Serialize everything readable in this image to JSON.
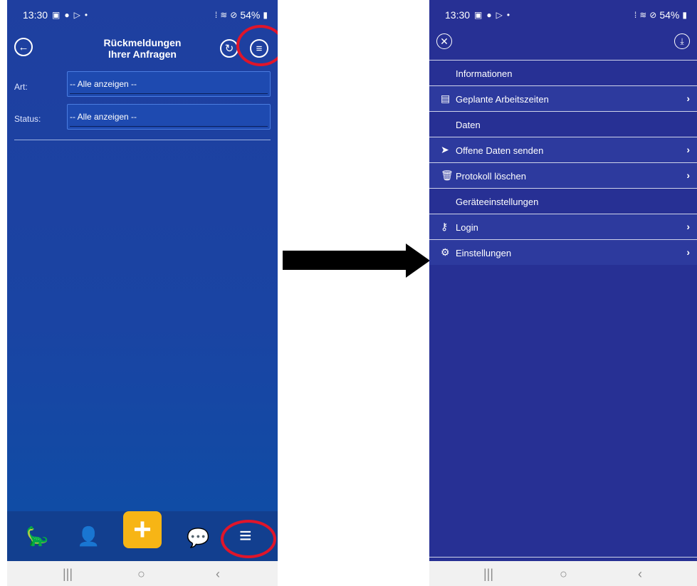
{
  "left": {
    "status": {
      "time": "13:30",
      "battery": "54%"
    },
    "header": {
      "title_line1": "Rückmeldungen",
      "title_line2": "Ihrer Anfragen"
    },
    "filters": [
      {
        "label": "Art:",
        "value": "-- Alle anzeigen --"
      },
      {
        "label": "Status:",
        "value": "-- Alle anzeigen --"
      }
    ],
    "icons": {
      "back": "back-arrow-icon",
      "refresh": "refresh-icon",
      "menu": "menu-icon"
    },
    "bottom_nav": [
      "dino-icon",
      "user-clock-icon",
      "add-icon",
      "chat-icon",
      "hamburger-icon"
    ],
    "accent": "#f7b515",
    "highlight": "#e0152a"
  },
  "right": {
    "status": {
      "time": "13:30",
      "battery": "54%"
    },
    "menu": [
      {
        "type": "section",
        "label": "Informationen"
      },
      {
        "type": "item",
        "icon": "calendar-icon",
        "label": "Geplante Arbeitszeiten"
      },
      {
        "type": "section",
        "label": "Daten"
      },
      {
        "type": "item",
        "icon": "send-icon",
        "label": "Offene Daten senden"
      },
      {
        "type": "item",
        "icon": "trash-icon",
        "label": "Protokoll löschen"
      },
      {
        "type": "section",
        "label": "Geräteeinstellungen"
      },
      {
        "type": "item",
        "icon": "key-icon",
        "label": "Login"
      },
      {
        "type": "item",
        "icon": "gear-icon",
        "label": "Einstellungen"
      }
    ]
  }
}
